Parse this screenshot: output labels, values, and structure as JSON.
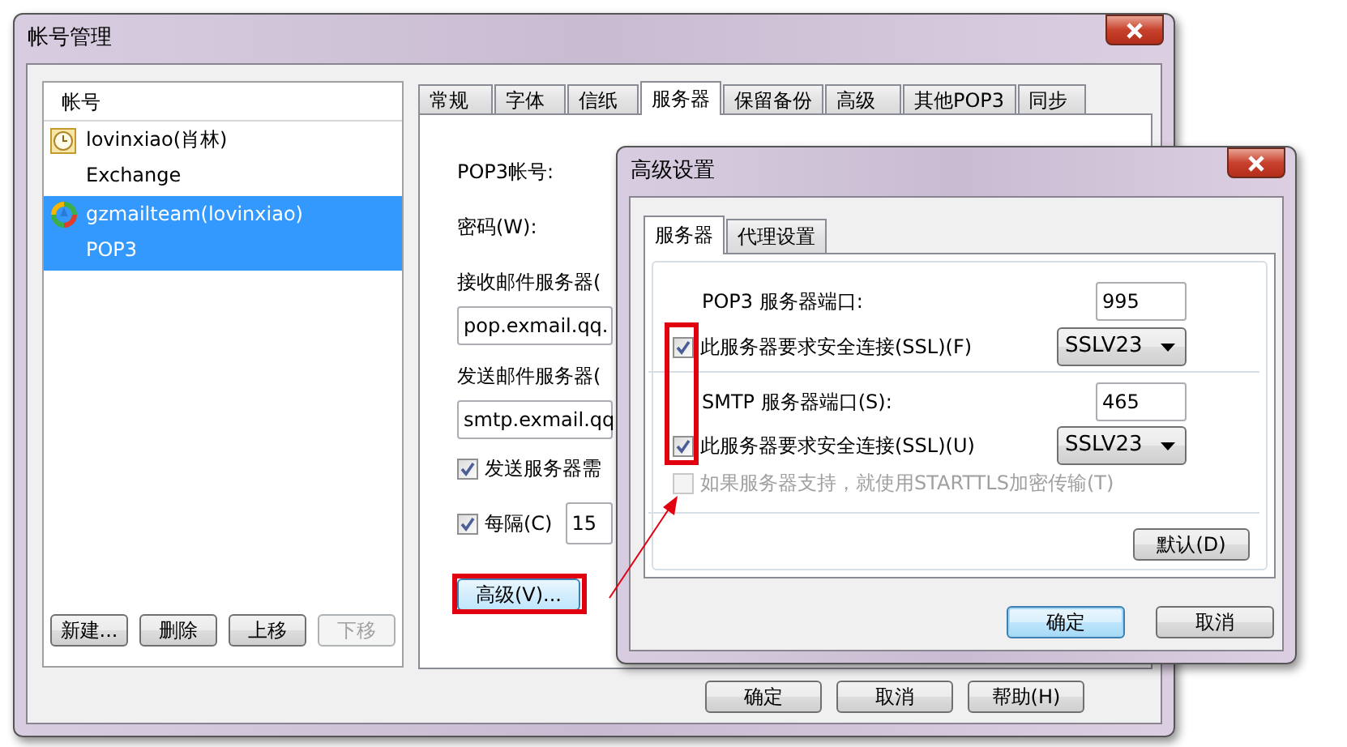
{
  "main_window": {
    "title": "帐号管理",
    "account_list": {
      "header": "帐号",
      "items": [
        {
          "name": "lovinxiao(肖林)",
          "type": "Exchange",
          "kind": "exchange",
          "selected": false
        },
        {
          "name": "gzmailteam(lovinxiao)",
          "type": "POP3",
          "kind": "pop3",
          "selected": true
        }
      ]
    },
    "list_buttons": [
      {
        "label": "新建...",
        "disabled": false
      },
      {
        "label": "删除",
        "disabled": false
      },
      {
        "label": "上移",
        "disabled": false
      },
      {
        "label": "下移",
        "disabled": true
      }
    ],
    "tabs": [
      {
        "label": "常规",
        "selected": false
      },
      {
        "label": "字体",
        "selected": false
      },
      {
        "label": "信纸",
        "selected": false
      },
      {
        "label": "服务器",
        "selected": true
      },
      {
        "label": "保留备份",
        "selected": false
      },
      {
        "label": "高级",
        "selected": false
      },
      {
        "label": "其他POP3",
        "selected": false
      },
      {
        "label": "同步",
        "selected": false
      }
    ],
    "server_tab": {
      "pop3_account_label": "POP3帐号:",
      "password_label": "密码(W):",
      "incoming_label": "接收邮件服务器(",
      "incoming_value": "pop.exmail.qq.",
      "outgoing_label": "发送邮件服务器(",
      "outgoing_value": "smtp.exmail.qq",
      "auth_checkbox": {
        "label": "发送服务器需",
        "checked": true
      },
      "interval_checkbox": {
        "label": "每隔(C)",
        "checked": true
      },
      "interval_value": "15",
      "advanced_button": "高级(V)..."
    },
    "buttons": [
      "确定",
      "取消",
      "帮助(H)"
    ]
  },
  "advanced_dialog": {
    "title": "高级设置",
    "tabs": [
      {
        "label": "服务器",
        "selected": true
      },
      {
        "label": "代理设置",
        "selected": false
      }
    ],
    "pop3_port_label": "POP3 服务器端口:",
    "pop3_port": "995",
    "pop3_ssl": {
      "label": "此服务器要求安全连接(SSL)(F)",
      "checked": true,
      "disabled": false
    },
    "pop3_ssl_version": "SSLV23",
    "smtp_port_label": "SMTP 服务器端口(S):",
    "smtp_port": "465",
    "smtp_ssl": {
      "label": "此服务器要求安全连接(SSL)(U)",
      "checked": true,
      "disabled": false
    },
    "smtp_ssl_version": "SSLV23",
    "starttls": {
      "label": "如果服务器支持，就使用STARTTLS加密传输(T)",
      "checked": false,
      "disabled": true
    },
    "default_button": "默认(D)",
    "buttons": [
      "确定",
      "取消"
    ]
  }
}
